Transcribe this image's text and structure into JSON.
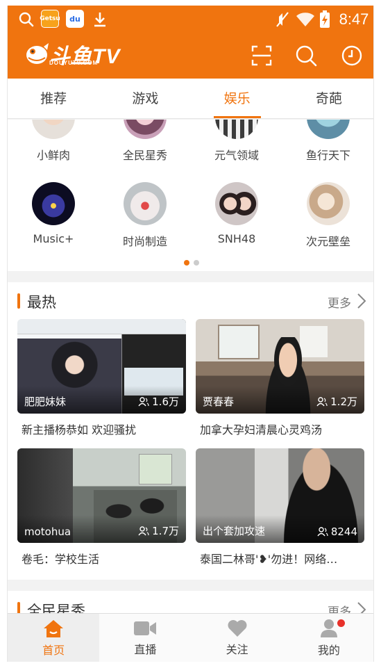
{
  "status": {
    "time": "8:47",
    "badge_app": "Getsu",
    "badge_baidu": "du"
  },
  "header": {
    "logo_text": "斗鱼TV",
    "logo_sub": "DOUYUTV.COM"
  },
  "tabs": [
    {
      "label": "推荐"
    },
    {
      "label": "游戏"
    },
    {
      "label": "娱乐"
    },
    {
      "label": "奇葩"
    }
  ],
  "active_tab": "娱乐",
  "categories": [
    {
      "label": "小鲜肉"
    },
    {
      "label": "全民星秀"
    },
    {
      "label": "元气领域"
    },
    {
      "label": "鱼行天下"
    },
    {
      "label": "Music+"
    },
    {
      "label": "时尚制造"
    },
    {
      "label": "SNH48"
    },
    {
      "label": "次元壁垒"
    }
  ],
  "hot": {
    "title": "最热",
    "more": "更多",
    "cards": [
      {
        "anchor": "肥肥妹妹",
        "viewers": "1.6万",
        "title": "新主播杨恭如 欢迎骚扰"
      },
      {
        "anchor": "贾春春",
        "viewers": "1.2万",
        "title": "加拿大孕妇清晨心灵鸡汤"
      },
      {
        "anchor": "motohua",
        "viewers": "1.7万",
        "title": "卷毛：学校生活"
      },
      {
        "anchor": "出个套加攻速",
        "viewers": "8244",
        "title": "泰国二林哥'❥'勿进！网络…"
      }
    ]
  },
  "next_section": {
    "title": "全民星秀",
    "more": "更多"
  },
  "bottom_nav": [
    {
      "label": "首页",
      "icon": "home-icon"
    },
    {
      "label": "直播",
      "icon": "video-camera-icon"
    },
    {
      "label": "关注",
      "icon": "heart-icon"
    },
    {
      "label": "我的",
      "icon": "user-icon"
    }
  ],
  "colors": {
    "accent": "#f0740f",
    "badge_red": "#e8312a"
  }
}
